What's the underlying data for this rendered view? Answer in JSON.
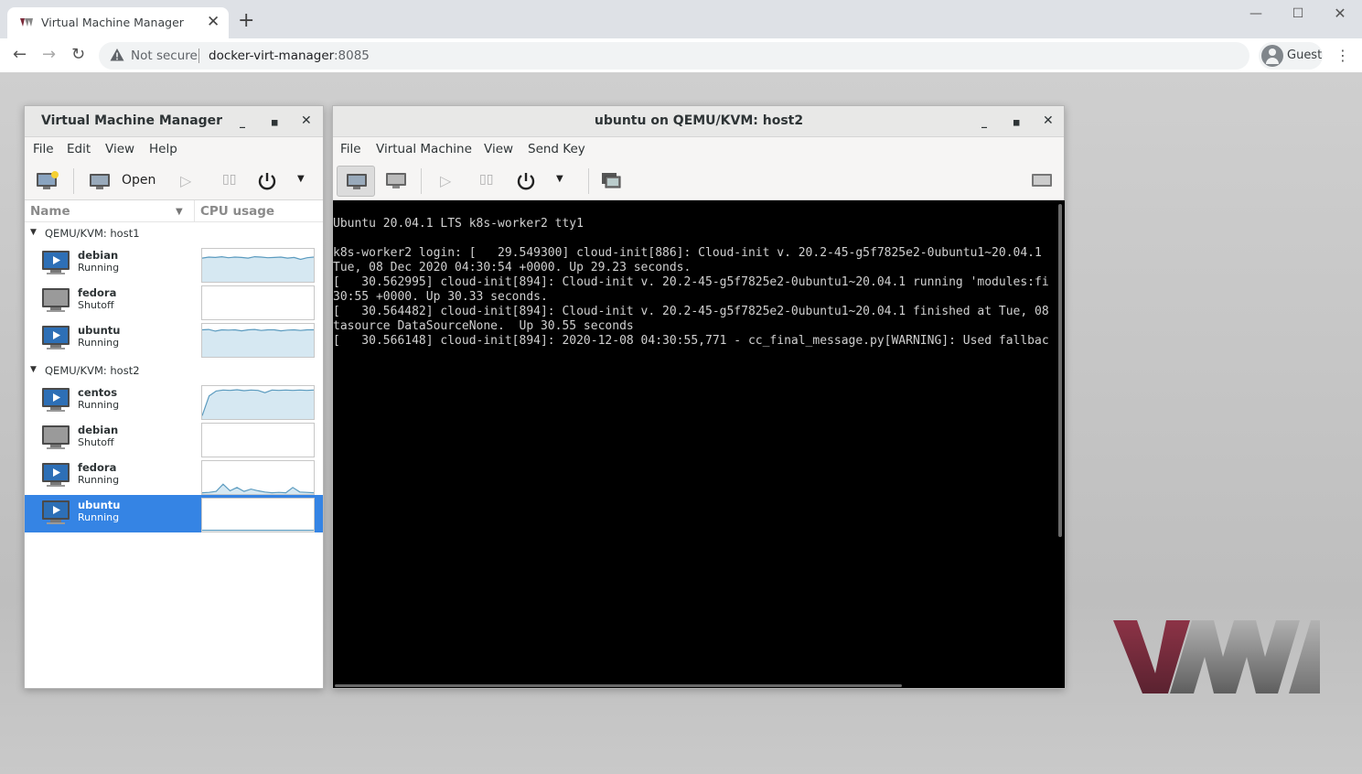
{
  "browser": {
    "tab_title": "Virtual Machine Manager",
    "security_label": "Not secure",
    "url_host": "docker-virt-manager",
    "url_port": ":8085",
    "profile_label": "Guest"
  },
  "manager": {
    "title": "Virtual Machine Manager",
    "menus": [
      "File",
      "Edit",
      "View",
      "Help"
    ],
    "open_label": "Open",
    "columns": {
      "name": "Name",
      "cpu": "CPU usage"
    },
    "groups": [
      {
        "label": "QEMU/KVM: host1",
        "vms": [
          {
            "name": "debian",
            "state": "Running",
            "cpu": [
              0.72,
              0.75,
              0.74,
              0.76,
              0.73,
              0.75,
              0.74,
              0.72,
              0.76,
              0.75,
              0.73,
              0.74,
              0.75,
              0.72,
              0.74,
              0.68,
              0.73,
              0.75
            ]
          },
          {
            "name": "fedora",
            "state": "Shutoff",
            "cpu": []
          },
          {
            "name": "ubuntu",
            "state": "Running",
            "cpu": [
              0.82,
              0.83,
              0.78,
              0.82,
              0.81,
              0.82,
              0.79,
              0.82,
              0.83,
              0.8,
              0.82,
              0.82,
              0.79,
              0.81,
              0.82,
              0.8,
              0.82,
              0.82
            ]
          }
        ]
      },
      {
        "label": "QEMU/KVM: host2",
        "vms": [
          {
            "name": "centos",
            "state": "Running",
            "cpu": [
              0.1,
              0.7,
              0.85,
              0.88,
              0.87,
              0.89,
              0.86,
              0.88,
              0.87,
              0.8,
              0.88,
              0.87,
              0.88,
              0.87,
              0.88,
              0.87,
              0.88
            ]
          },
          {
            "name": "debian",
            "state": "Shutoff",
            "cpu": []
          },
          {
            "name": "fedora",
            "state": "Running",
            "cpu": [
              0.04,
              0.05,
              0.08,
              0.3,
              0.1,
              0.2,
              0.08,
              0.15,
              0.1,
              0.06,
              0.04,
              0.05,
              0.04,
              0.2,
              0.06,
              0.05,
              0.04
            ]
          },
          {
            "name": "ubuntu",
            "state": "Running",
            "cpu": [
              0.04,
              0.04,
              0.04,
              0.04,
              0.04,
              0.04,
              0.04,
              0.04,
              0.04,
              0.04,
              0.04,
              0.04
            ],
            "selected": true
          }
        ]
      }
    ]
  },
  "console_window": {
    "title": "ubuntu on QEMU/KVM: host2",
    "menus": [
      "File",
      "Virtual Machine",
      "View",
      "Send Key"
    ],
    "lines": [
      "Ubuntu 20.04.1 LTS k8s-worker2 tty1",
      "",
      "k8s-worker2 login: [   29.549300] cloud-init[886]: Cloud-init v. 20.2-45-g5f7825e2-0ubuntu1~20.04.1",
      "Tue, 08 Dec 2020 04:30:54 +0000. Up 29.23 seconds.",
      "[   30.562995] cloud-init[894]: Cloud-init v. 20.2-45-g5f7825e2-0ubuntu1~20.04.1 running 'modules:fi",
      "30:55 +0000. Up 30.33 seconds.",
      "[   30.564482] cloud-init[894]: Cloud-init v. 20.2-45-g5f7825e2-0ubuntu1~20.04.1 finished at Tue, 08",
      "tasource DataSourceNone.  Up 30.55 seconds",
      "[   30.566148] cloud-init[894]: 2020-12-08 04:30:55,771 - cc_final_message.py[WARNING]: Used fallbac"
    ]
  },
  "colors": {
    "selection": "#3584e4",
    "sparkline_fill": "#d6e8f2",
    "sparkline_line": "#5b9bbf",
    "logo_red": "#7a2a3a"
  }
}
